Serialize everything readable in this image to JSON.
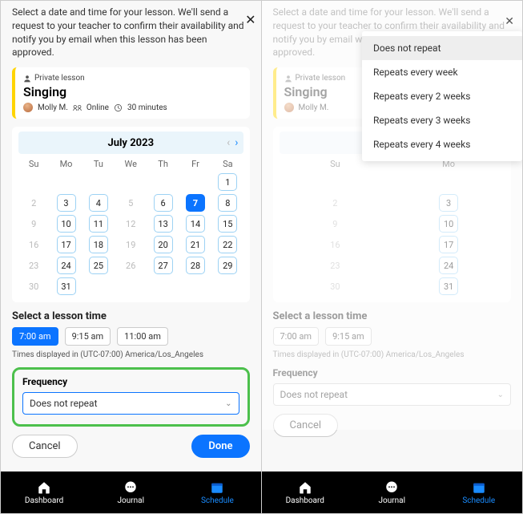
{
  "instruction": "Select a date and time for your lesson. We'll send a request to your teacher to confirm their availability and notify you by email when this lesson has been approved.",
  "lesson": {
    "type_label": "Private lesson",
    "title": "Singing",
    "teacher": "Molly M.",
    "mode": "Online",
    "duration": "30 minutes"
  },
  "calendar": {
    "title": "July 2023",
    "dow": [
      "Su",
      "Mo",
      "Tu",
      "We",
      "Th",
      "Fr",
      "Sa"
    ],
    "weeks": [
      [
        null,
        null,
        null,
        null,
        null,
        null,
        {
          "d": 1,
          "av": true
        }
      ],
      [
        {
          "d": 2
        },
        {
          "d": 3,
          "av": true
        },
        {
          "d": 4,
          "av": true
        },
        {
          "d": 5
        },
        {
          "d": 6,
          "av": true
        },
        {
          "d": 7,
          "av": true,
          "sel": true
        },
        {
          "d": 8,
          "av": true
        }
      ],
      [
        {
          "d": 9
        },
        {
          "d": 10,
          "av": true
        },
        {
          "d": 11,
          "av": true
        },
        {
          "d": 12
        },
        {
          "d": 13,
          "av": true
        },
        {
          "d": 14,
          "av": true
        },
        {
          "d": 15,
          "av": true
        }
      ],
      [
        {
          "d": 16
        },
        {
          "d": 17,
          "av": true
        },
        {
          "d": 18,
          "av": true
        },
        {
          "d": 19
        },
        {
          "d": 20,
          "av": true
        },
        {
          "d": 21,
          "av": true
        },
        {
          "d": 22,
          "av": true
        }
      ],
      [
        {
          "d": 23
        },
        {
          "d": 24,
          "av": true
        },
        {
          "d": 25,
          "av": true
        },
        {
          "d": 26
        },
        {
          "d": 27,
          "av": true
        },
        {
          "d": 28,
          "av": true
        },
        {
          "d": 29,
          "av": true
        }
      ],
      [
        {
          "d": 30
        },
        {
          "d": 31,
          "av": true
        },
        null,
        null,
        null,
        null,
        null
      ]
    ]
  },
  "time_section": {
    "heading": "Select a lesson time",
    "options": [
      {
        "label": "7:00 am",
        "selected": true
      },
      {
        "label": "9:15 am",
        "selected": false
      },
      {
        "label": "11:00 am",
        "selected": false
      }
    ],
    "tz_note": "Times displayed in (UTC-07:00) America/Los_Angeles"
  },
  "frequency": {
    "label": "Frequency",
    "value": "Does not repeat",
    "options": [
      "Does not repeat",
      "Repeats every week",
      "Repeats every 2 weeks",
      "Repeats every 3 weeks",
      "Repeats every 4 weeks"
    ]
  },
  "actions": {
    "cancel": "Cancel",
    "done": "Done"
  },
  "tabs": [
    {
      "label": "Dashboard",
      "icon": "home",
      "active": false
    },
    {
      "label": "Journal",
      "icon": "chat",
      "active": false
    },
    {
      "label": "Schedule",
      "icon": "calendar",
      "active": true
    }
  ]
}
